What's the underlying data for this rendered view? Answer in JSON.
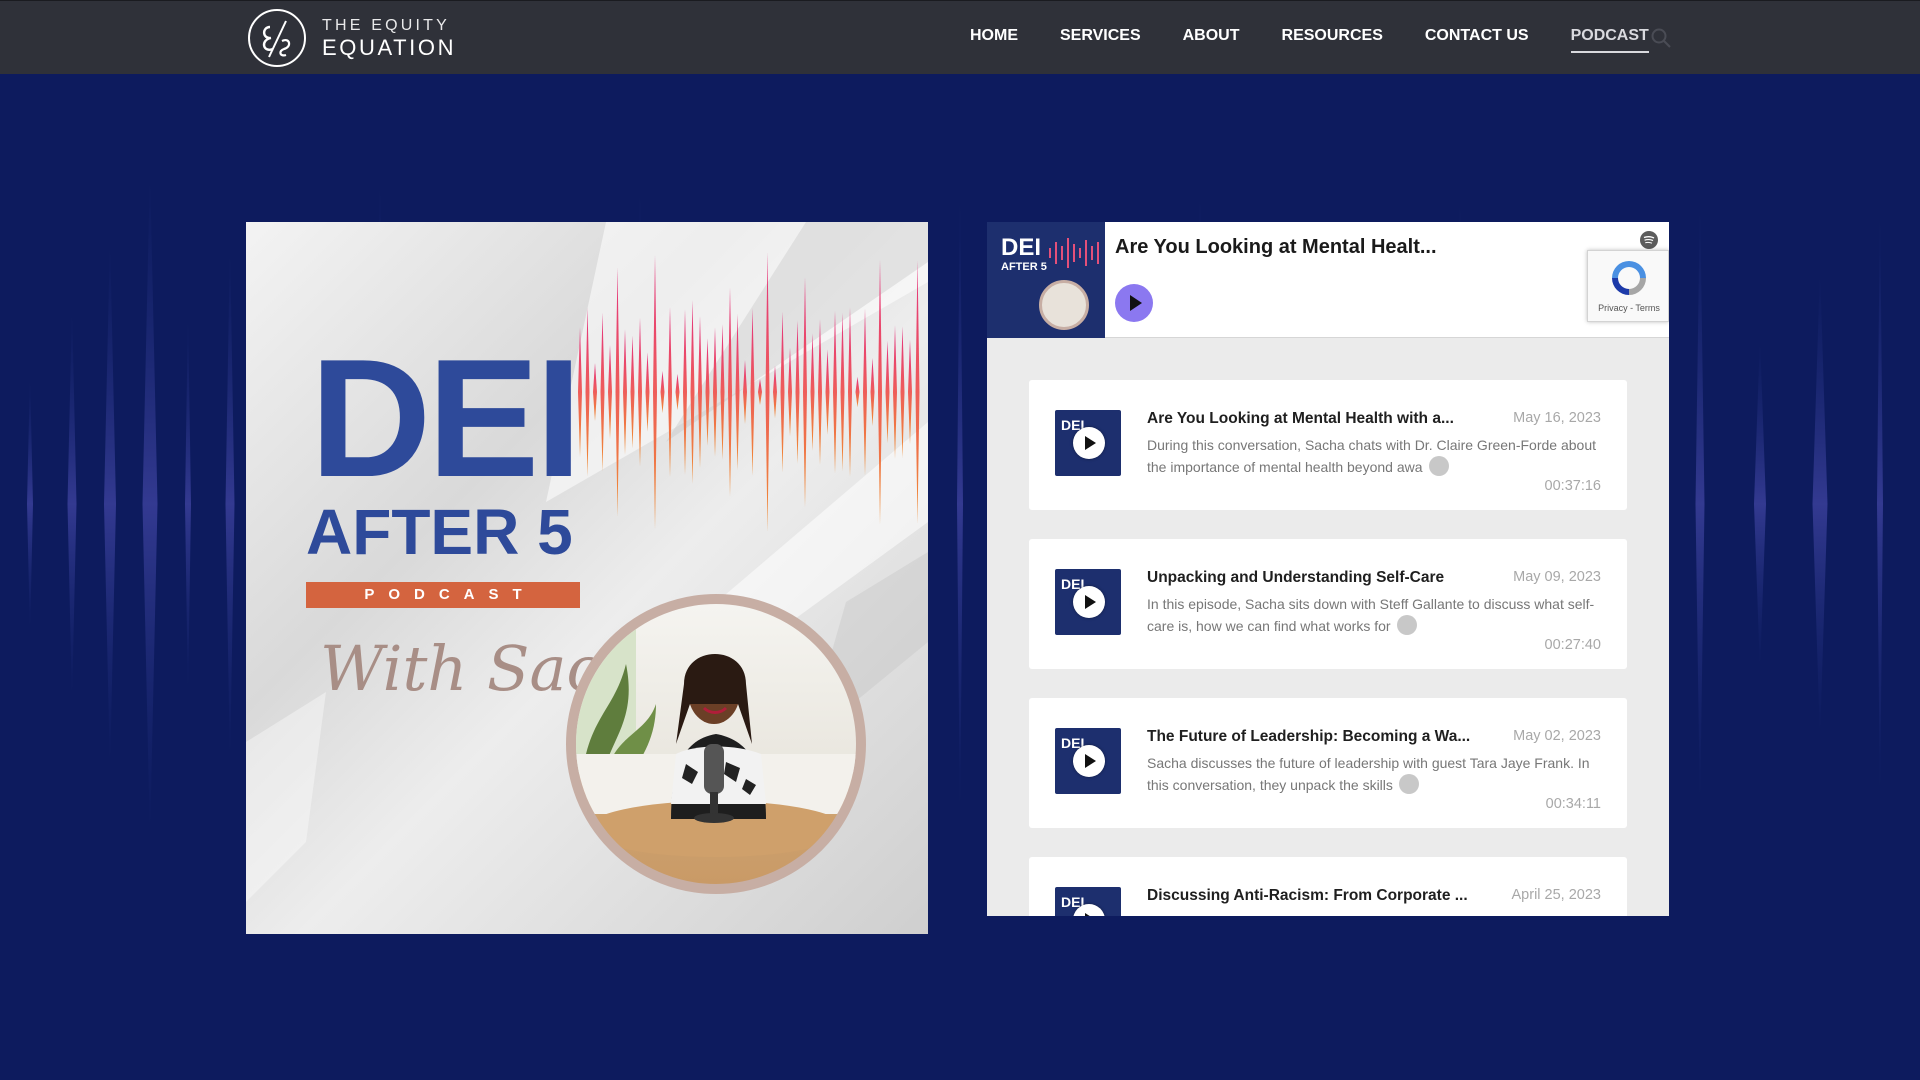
{
  "site": {
    "logo_line1": "THE EQUITY",
    "logo_line2": "EQUATION"
  },
  "nav": {
    "items": [
      {
        "label": "HOME",
        "active": false
      },
      {
        "label": "SERVICES",
        "active": false
      },
      {
        "label": "ABOUT",
        "active": false
      },
      {
        "label": "RESOURCES",
        "active": false
      },
      {
        "label": "CONTACT US",
        "active": false
      },
      {
        "label": "PODCAST",
        "active": true
      }
    ],
    "search_icon": "search-icon"
  },
  "cover": {
    "title": "DEI",
    "subtitle": "AFTER 5",
    "badge": "PODCAST",
    "script": "With Sacha"
  },
  "player": {
    "now_playing_title": "Are You Looking at Mental Healt...",
    "thumb_title": "DEI",
    "thumb_subtitle": "AFTER 5",
    "recaptcha_links": "Privacy - Terms",
    "episodes": [
      {
        "title": "Are You Looking at Mental Health with a...",
        "date": "May 16, 2023",
        "description": "During this conversation, Sacha chats with Dr. Claire Green-Forde about the importance of mental health beyond awa",
        "duration": "00:37:16"
      },
      {
        "title": "Unpacking and Understanding Self-Care",
        "date": "May 09, 2023",
        "description": "In this episode, Sacha sits down with Steff Gallante to discuss what self-care is, how we can find what works for",
        "duration": "00:27:40"
      },
      {
        "title": "The Future of Leadership: Becoming a Wa...",
        "date": "May 02, 2023",
        "description": "Sacha discusses the future of leadership with guest Tara Jaye Frank. In this conversation, they unpack the skills",
        "duration": "00:34:11"
      },
      {
        "title": "Discussing Anti-Racism: From Corporate ...",
        "date": "April 25, 2023",
        "description": "",
        "duration": ""
      }
    ],
    "episode_thumb_label": "DEI"
  },
  "colors": {
    "background": "#0d1b5e",
    "topbar": "#2f3139",
    "cover_blue": "#2e4a9a",
    "badge_orange": "#d4643f",
    "play_purple": "#8b78f0"
  }
}
